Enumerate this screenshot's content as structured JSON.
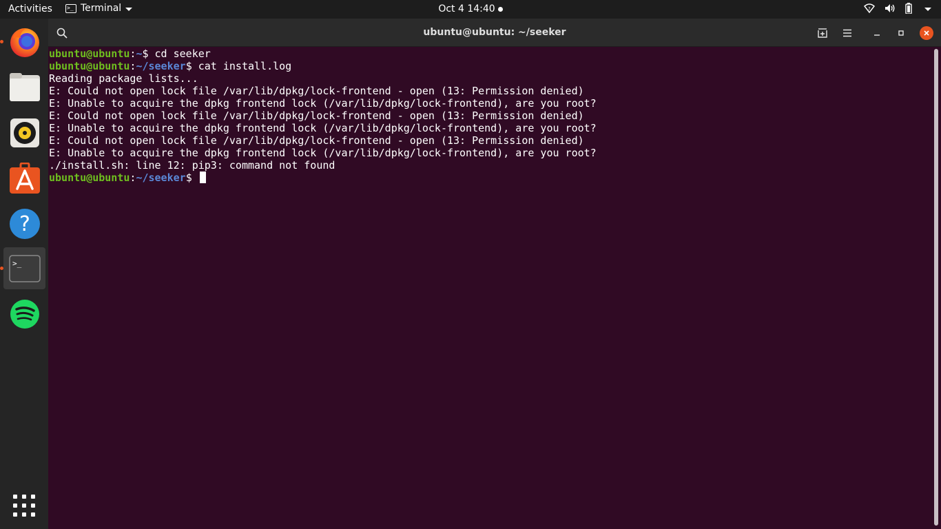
{
  "topbar": {
    "activities": "Activities",
    "app_name": "Terminal",
    "clock": "Oct 4  14:40",
    "icons": [
      "network-wireless-icon",
      "volume-icon",
      "battery-icon",
      "system-menu-caret-icon"
    ]
  },
  "dock": {
    "items": [
      {
        "name": "firefox",
        "icon": "firefox-icon",
        "running": true
      },
      {
        "name": "files",
        "icon": "files-icon",
        "running": false
      },
      {
        "name": "rhythmbox",
        "icon": "rhythmbox-icon",
        "running": false
      },
      {
        "name": "software",
        "icon": "ubuntu-software-icon",
        "running": false
      },
      {
        "name": "help",
        "icon": "help-icon",
        "running": false
      },
      {
        "name": "terminal",
        "icon": "terminal-icon",
        "running": true,
        "active": true
      },
      {
        "name": "spotify",
        "icon": "spotify-icon",
        "running": false
      }
    ],
    "show_apps_icon": "app-grid-icon"
  },
  "window": {
    "title": "ubuntu@ubuntu: ~/seeker",
    "header_icons": [
      "search-icon",
      "new-tab-icon",
      "hamburger-menu-icon",
      "minimize-icon",
      "maximize-icon",
      "close-icon"
    ]
  },
  "terminal": {
    "prompt_user": "ubuntu@ubuntu",
    "lines": [
      {
        "type": "prompt",
        "path": "~",
        "cmd": " cd seeker"
      },
      {
        "type": "prompt",
        "path": "~/seeker",
        "cmd": " cat install.log"
      },
      {
        "type": "output",
        "text": "Reading package lists..."
      },
      {
        "type": "output",
        "text": "E: Could not open lock file /var/lib/dpkg/lock-frontend - open (13: Permission denied)"
      },
      {
        "type": "output",
        "text": "E: Unable to acquire the dpkg frontend lock (/var/lib/dpkg/lock-frontend), are you root?"
      },
      {
        "type": "output",
        "text": "E: Could not open lock file /var/lib/dpkg/lock-frontend - open (13: Permission denied)"
      },
      {
        "type": "output",
        "text": "E: Unable to acquire the dpkg frontend lock (/var/lib/dpkg/lock-frontend), are you root?"
      },
      {
        "type": "output",
        "text": "E: Could not open lock file /var/lib/dpkg/lock-frontend - open (13: Permission denied)"
      },
      {
        "type": "output",
        "text": "E: Unable to acquire the dpkg frontend lock (/var/lib/dpkg/lock-frontend), are you root?"
      },
      {
        "type": "output",
        "text": "./install.sh: line 12: pip3: command not found"
      },
      {
        "type": "prompt",
        "path": "~/seeker",
        "cmd": " ",
        "cursor": true
      }
    ]
  },
  "colors": {
    "terminal_bg": "#300a24",
    "prompt_user": "#6fbf1f",
    "prompt_path": "#5a87d6",
    "accent": "#e95420"
  }
}
